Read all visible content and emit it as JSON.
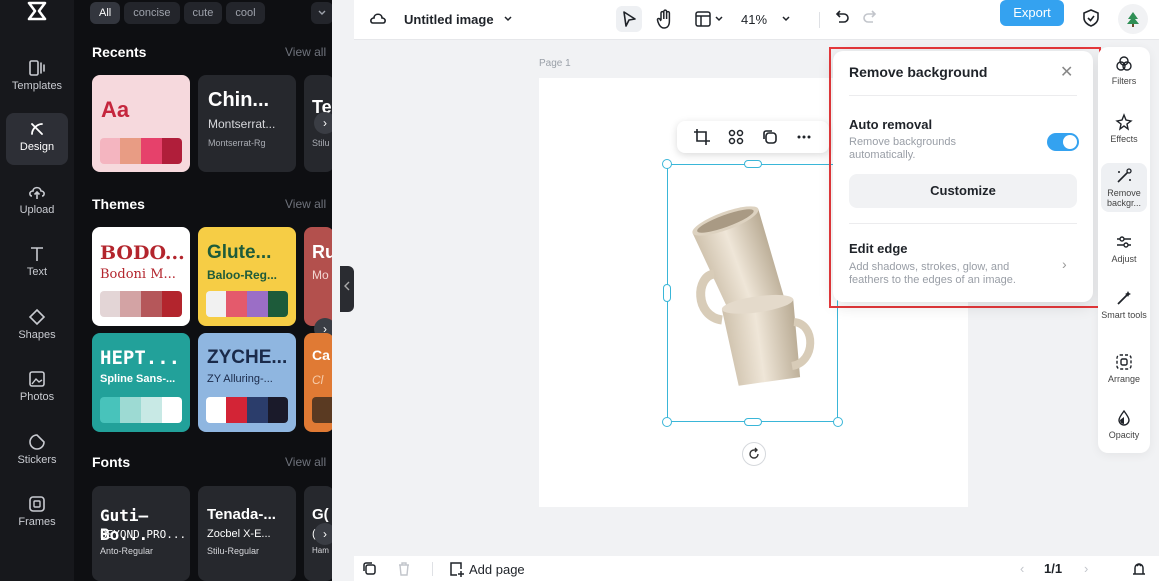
{
  "rail": {
    "items": [
      {
        "label": "Templates",
        "icon": "templates-icon"
      },
      {
        "label": "Design",
        "icon": "design-icon"
      },
      {
        "label": "Upload",
        "icon": "upload-icon"
      },
      {
        "label": "Text",
        "icon": "text-icon"
      },
      {
        "label": "Shapes",
        "icon": "shapes-icon"
      },
      {
        "label": "Photos",
        "icon": "photos-icon"
      },
      {
        "label": "Stickers",
        "icon": "stickers-icon"
      },
      {
        "label": "Frames",
        "icon": "frames-icon"
      }
    ],
    "active": "Design"
  },
  "panel": {
    "chips": [
      "All",
      "concise",
      "cute",
      "cool"
    ],
    "recents": {
      "title": "Recents",
      "view_all": "View all",
      "cards": [
        {
          "big": "Aa",
          "bg": "#f6d9dd",
          "big_color": "#c5263d",
          "swatches": [
            "#f4b5c0",
            "#e89c84",
            "#e6416b",
            "#b01e3a"
          ]
        },
        {
          "big": "Chin...",
          "font": "Montserrat...",
          "sub": "Montserrat-Rg",
          "bg": "#26282d"
        },
        {
          "big": "Te",
          "sub": "Stilu",
          "bg": "#26282d"
        }
      ]
    },
    "themes": {
      "title": "Themes",
      "view_all": "View all",
      "cards": [
        {
          "big": "BODO...",
          "sub": "Bodoni M...",
          "bg": "#ffffff",
          "big_color": "#b3252d",
          "sub_color": "#b3252d",
          "swatches": [
            "#e3d5d6",
            "#d3a3a4",
            "#b5575a",
            "#b3252d"
          ]
        },
        {
          "big": "Glute...",
          "sub": "Baloo-Reg...",
          "bg": "#f6cd45",
          "big_color": "#1d5b3a",
          "sub_color": "#1d5b3a",
          "swatches": [
            "#f1f1f1",
            "#e45a6c",
            "#9b6ec6",
            "#1d5b3a"
          ]
        },
        {
          "big": "Ru",
          "sub": "Mo",
          "bg": "#b3504d",
          "big_color": "#ffffff",
          "sub_color": "#f3d7d2"
        },
        {
          "big": "HEPT...",
          "sub": "Spline Sans-...",
          "bg": "#22a19a",
          "big_color": "#ffffff",
          "sub_color": "#ffffff",
          "swatches": [
            "#48c3bb",
            "#9ddad3",
            "#c8e9e5",
            "#ffffff"
          ]
        },
        {
          "big": "ZYCHE...",
          "sub": "ZY Alluring-...",
          "bg": "#8fb6e0",
          "big_color": "#1a2a4a",
          "sub_color": "#1a2a4a",
          "swatches": [
            "#ffffff",
            "#d32436",
            "#2b3d6b",
            "#1a1a2a"
          ]
        },
        {
          "big": "Ca",
          "sub": "Cl",
          "bg": "#e07a34",
          "big_color": "#ffffff",
          "sub_color": "#f6cba9"
        }
      ]
    },
    "fonts": {
      "title": "Fonts",
      "view_all": "View all",
      "cards": [
        {
          "big": "Guti–Bo...",
          "mid": "BEYOND PRO...",
          "sub": "Anto-Regular"
        },
        {
          "big": "Tenada-...",
          "mid": "Zocbel X-E...",
          "sub": "Stilu-Regular"
        },
        {
          "big": "G(",
          "mid": "(",
          "sub": "Ham"
        }
      ]
    }
  },
  "topbar": {
    "doc_title": "Untitled image",
    "zoom": "41%",
    "export_label": "Export"
  },
  "canvas": {
    "page_label": "Page 1"
  },
  "remove_bg": {
    "title": "Remove background",
    "auto_title": "Auto removal",
    "auto_sub": "Remove backgrounds automatically.",
    "auto_enabled": true,
    "customize_label": "Customize",
    "edge_title": "Edit edge",
    "edge_sub": "Add shadows, strokes, glow, and feathers to the edges of an image."
  },
  "tools": [
    {
      "label": "Filters",
      "icon": "filters-icon"
    },
    {
      "label": "Effects",
      "icon": "effects-icon"
    },
    {
      "label": "Remove backgr...",
      "icon": "remove-background-icon"
    },
    {
      "label": "Adjust",
      "icon": "adjust-icon"
    },
    {
      "label": "Smart tools",
      "icon": "smart-tools-icon"
    },
    {
      "label": "Arrange",
      "icon": "arrange-icon"
    },
    {
      "label": "Opacity",
      "icon": "opacity-icon"
    }
  ],
  "bottombar": {
    "add_page": "Add page",
    "page_count": "1/1"
  },
  "colors": {
    "accent": "#34a2f0",
    "highlight": "#e5383b",
    "selection": "#3ab6d8"
  }
}
